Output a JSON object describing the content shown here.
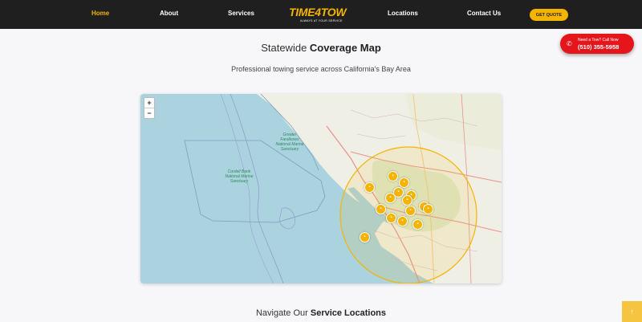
{
  "nav": {
    "links": [
      "Home",
      "About",
      "Services",
      "Locations",
      "Contact Us"
    ],
    "logo": {
      "main": "TIME4TOW",
      "tagline": "ALWAYS AT YOUR SERVICE"
    },
    "quote_button": "GET QUOTE"
  },
  "call_button": {
    "top": "Need a Tow? Call Now",
    "number": "(510) 355-5958",
    "icon": "phone-icon"
  },
  "coverage": {
    "title_prefix": "Statewide",
    "title_bold": "Coverage Map",
    "subtitle": "Professional towing service across California's Bay Area"
  },
  "map": {
    "zoom_in": "+",
    "zoom_out": "−",
    "labels": [
      {
        "name": "Greater Farallones National Marine Sanctuary"
      },
      {
        "name": "Cordell Bank National Marine Sanctuary"
      }
    ],
    "marker_icon": "truck-icon",
    "marker_count": 15
  },
  "locations_section": {
    "title_prefix": "Navigate Our",
    "title_bold": "Service Locations"
  },
  "scroll_top_icon": "arrow-up-icon",
  "colors": {
    "accent": "#f5b400",
    "nav_bg": "#1f1f1f",
    "call_red": "#e4161b",
    "water": "#aad3df",
    "land": "#f0efe6"
  }
}
